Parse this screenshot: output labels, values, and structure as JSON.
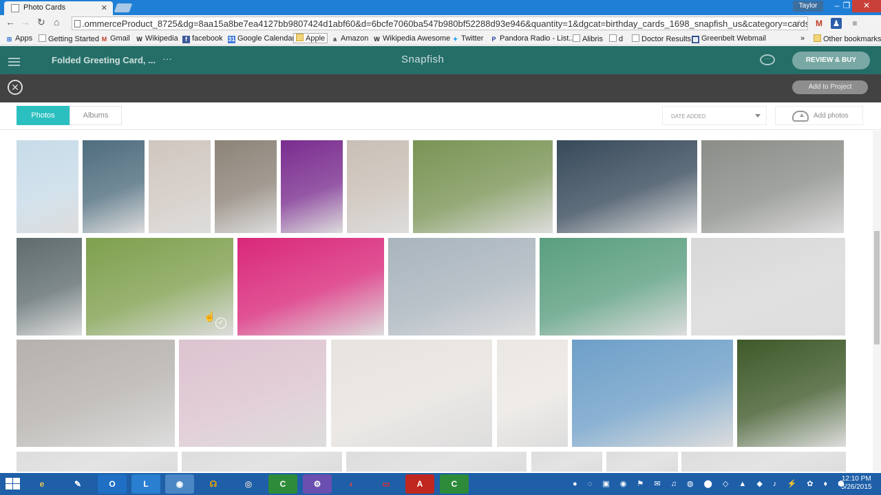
{
  "browser": {
    "tab_title": "Photo Cards",
    "user": "Taylor",
    "url": ".ommerceProduct_8725&dg=8aa15a8be7ea4127bb9807424d1abf60&d=6bcfe7060ba547b980bf52288d93e946&quantity=1&dgcat=birthday_cards_1698_snapfish_us&category=cards",
    "bookmarks": [
      "Apps",
      "Getting Started",
      "Gmail",
      "Wikipedia",
      "facebook",
      "Google Calendar",
      "Apple",
      "Amazon",
      "Wikipedia Awesome",
      "Twitter",
      "Pandora Radio - List...",
      "Alibris",
      "d",
      "Doctor Results",
      "Greenbelt Webmail"
    ],
    "bookmarks_overflow": "»",
    "other_bookmarks": "Other bookmarks"
  },
  "header": {
    "project_name": "Folded Greeting Card, ...",
    "more": "···",
    "brand": "Snapfish",
    "review_button": "REVIEW & BUY"
  },
  "panel": {
    "close_glyph": "✕",
    "add_to_project": "Add to Project"
  },
  "chooser": {
    "tabs": [
      "Photos",
      "Albums"
    ],
    "sort_selected": "DATE ADDED",
    "add_photos": "Add photos"
  },
  "photos": {
    "row1": [
      "#c7dbe8",
      "#4f6d7e",
      "#cfc6bf",
      "#8d8378",
      "#7a2d8f",
      "#c9bfb6",
      "#7a9455",
      "#384a5b",
      "#8a8d88"
    ],
    "row2": [
      "#5f6c6e",
      "#7fa04e",
      "#d9287a",
      "#a9b4bd",
      "#5a9e7f",
      "#d8d8d8"
    ],
    "row3": [
      "#b5b1ad",
      "#dcc3cf",
      "#e7e3df",
      "#ebe7e3",
      "#6e9fc8",
      "#3f5a2a"
    ],
    "row4": [
      "#dddddd",
      "#dddddd",
      "#dddddd",
      "#dddddd",
      "#dddddd",
      "#dddddd"
    ],
    "selected_check": "✓"
  },
  "taskbar": {
    "time": "12:10 PM",
    "date": "5/26/2015"
  }
}
